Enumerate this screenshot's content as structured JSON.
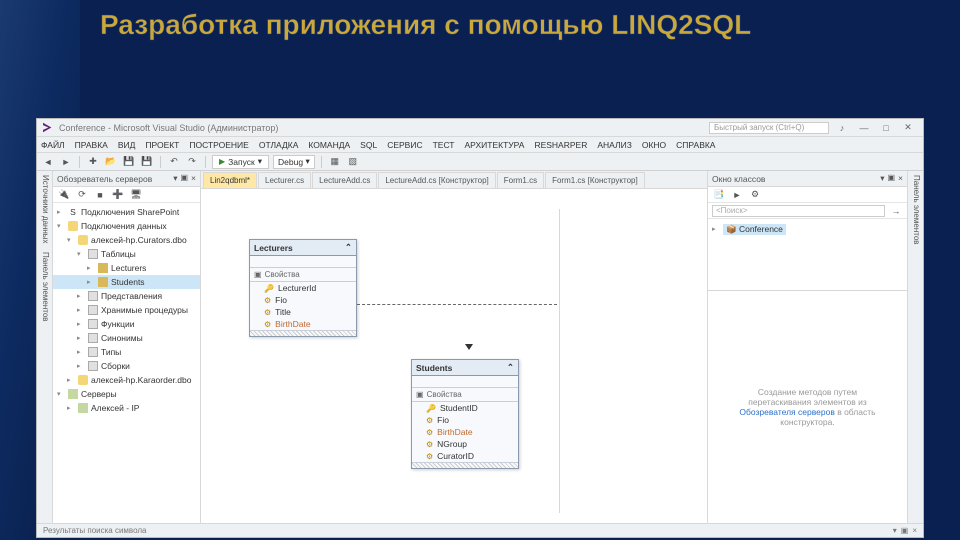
{
  "slide": {
    "title": "Разработка приложения с помощью LINQ2SQL"
  },
  "window": {
    "title": "Conference - Microsoft Visual Studio (Администратор)",
    "quicklaunch": "Быстрый запуск (Ctrl+Q)"
  },
  "menu": [
    "ФАЙЛ",
    "ПРАВКА",
    "ВИД",
    "ПРОЕКТ",
    "ПОСТРОЕНИЕ",
    "ОТЛАДКА",
    "КОМАНДА",
    "SQL",
    "СЕРВИС",
    "ТЕСТ",
    "АРХИТЕКТУРА",
    "RESHARPER",
    "АНАЛИЗ",
    "ОКНО",
    "СПРАВКА"
  ],
  "toolbar": {
    "config": "Debug",
    "start": "Запуск"
  },
  "tabs": [
    "Lin2qdbml*",
    "Lecturer.cs",
    "LectureAdd.cs",
    "LectureAdd.cs [Конструктор]",
    "Form1.cs",
    "Form1.cs [Конструктор]"
  ],
  "active_tab": 0,
  "left_strips": [
    "Источники данных",
    "Панель элементов"
  ],
  "right_strips": [
    "Панель элементов"
  ],
  "server_explorer": {
    "title": "Обозреватель серверов",
    "nodes": {
      "root1": "Подключения SharePoint",
      "root2": "Подключения данных",
      "conn": "алексей-hp.Curators.dbo",
      "tables": "Таблицы",
      "t1": "Lecturers",
      "t2": "Students",
      "views": "Представления",
      "procs": "Хранимые процедуры",
      "funcs": "Функции",
      "syn": "Синонимы",
      "types": "Типы",
      "asm": "Сборки",
      "conn2": "алексей-hp.Karaorder.dbo",
      "servers": "Серверы",
      "srv1": "Алексей - IP"
    }
  },
  "entities": {
    "lecturers": {
      "name": "Lecturers",
      "section": "Свойства",
      "props": [
        {
          "n": "LecturerId",
          "key": true
        },
        {
          "n": "Fio"
        },
        {
          "n": "Title"
        },
        {
          "n": "BirthDate",
          "link": true
        }
      ]
    },
    "students": {
      "name": "Students",
      "section": "Свойства",
      "props": [
        {
          "n": "StudentID",
          "key": true
        },
        {
          "n": "Fio"
        },
        {
          "n": "BirthDate",
          "link": true
        },
        {
          "n": "NGroup"
        },
        {
          "n": "CuratorID"
        }
      ]
    }
  },
  "class_view": {
    "title": "Окно классов",
    "search": "<Поиск>",
    "node": "Conference"
  },
  "methods_hint": {
    "l1": "Создание методов путем",
    "l2": "перетаскивания элементов из",
    "link": "Обозревателя серверов",
    "l3": " в область",
    "l4": "конструктора."
  },
  "bottom": {
    "label": "Результаты поиска символа"
  },
  "icons": {
    "min": "—",
    "max": "□",
    "close": "✕",
    "collapse": "⌃",
    "dropdown": "▾",
    "pin": "📌",
    "x": "×",
    "tri_r": "▸",
    "tri_d": "▾",
    "play": "▶",
    "refresh": "⟳"
  }
}
